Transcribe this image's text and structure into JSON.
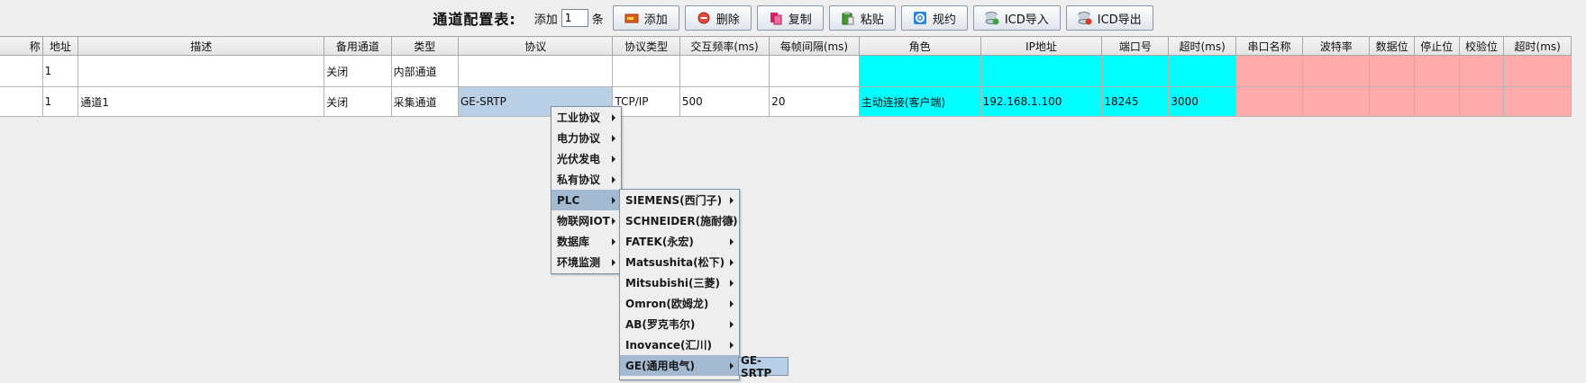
{
  "toolbar": {
    "title": "通道配置表:",
    "add_prefix": "添加",
    "add_count": "1",
    "add_suffix": "条",
    "buttons": [
      {
        "label": "添加",
        "icon": "add-icon"
      },
      {
        "label": "删除",
        "icon": "delete-icon"
      },
      {
        "label": "复制",
        "icon": "copy-icon"
      },
      {
        "label": "粘贴",
        "icon": "paste-icon"
      },
      {
        "label": "规约",
        "icon": "protocol-icon"
      },
      {
        "label": "ICD导入",
        "icon": "icd-import-icon"
      },
      {
        "label": "ICD导出",
        "icon": "icd-export-icon"
      }
    ]
  },
  "table": {
    "headers": [
      "称",
      "地址",
      "描述",
      "备用通道",
      "类型",
      "协议",
      "协议类型",
      "交互频率(ms)",
      "每帧间隔(ms)",
      "角色",
      "IP地址",
      "端口号",
      "超时(ms)",
      "串口名称",
      "波特率",
      "数据位",
      "停止位",
      "校验位",
      "超时(ms)"
    ],
    "rows": [
      [
        "",
        "1",
        "",
        "关闭",
        "内部通道",
        "",
        "",
        "",
        "",
        "",
        "",
        "",
        "",
        "",
        "",
        "",
        "",
        "",
        ""
      ],
      [
        "",
        "1",
        "通道1",
        "关闭",
        "采集通道",
        "GE-SRTP",
        "TCP/IP",
        "500",
        "20",
        "主动连接(客户端)",
        "192.168.1.100",
        "18245",
        "3000",
        "",
        "",
        "",
        "",
        "",
        ""
      ]
    ]
  },
  "menu1": {
    "items": [
      "工业协议",
      "电力协议",
      "光伏发电",
      "私有协议",
      "PLC",
      "物联网IOT",
      "数据库",
      "环境监测"
    ],
    "active_index": 4
  },
  "menu2": {
    "items": [
      "SIEMENS(西门子)",
      "SCHNEIDER(施耐德)",
      "FATEK(永宏)",
      "Matsushita(松下)",
      "Mitsubishi(三菱)",
      "Omron(欧姆龙)",
      "AB(罗克韦尔)",
      "Inovance(汇川)",
      "GE(通用电气)"
    ],
    "active_index": 8
  },
  "menu3": {
    "items": [
      "GE-SRTP"
    ]
  },
  "colors": {
    "network_cells": "#00ffff",
    "serial_cells": "#ffaaaa",
    "selected_cell": "#b8cfe5",
    "menu_highlight": "#a3bad1"
  }
}
